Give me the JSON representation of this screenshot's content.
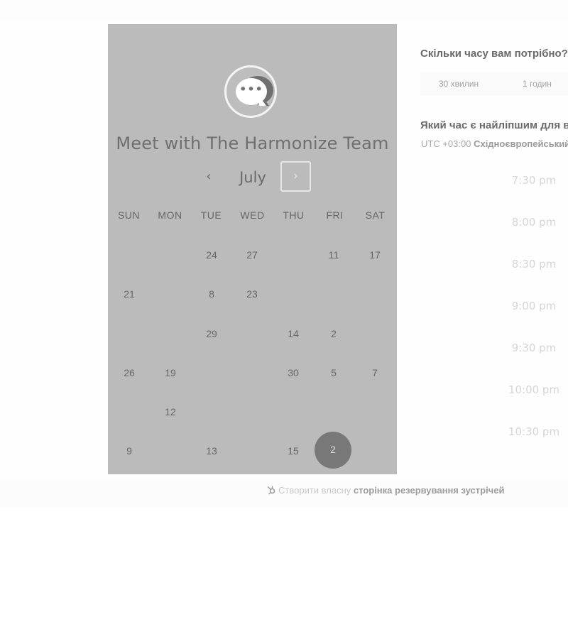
{
  "header": {
    "title": "Meet with The Harmonize Team"
  },
  "calendar": {
    "month": "July",
    "prev_label": "‹",
    "next_label": "›",
    "weekdays": [
      "SUN",
      "MON",
      "TUE",
      "WED",
      "THU",
      "FRI",
      "SAT"
    ],
    "days": [
      {
        "label": "24",
        "col": 2,
        "row": 0
      },
      {
        "label": "27",
        "col": 3,
        "row": 0
      },
      {
        "label": "11",
        "col": 5,
        "row": 0
      },
      {
        "label": "17",
        "col": 6,
        "row": 0
      },
      {
        "label": "21",
        "col": 0,
        "row": 1
      },
      {
        "label": "8",
        "col": 2,
        "row": 1
      },
      {
        "label": "23",
        "col": 3,
        "row": 1
      },
      {
        "label": "29",
        "col": 2,
        "row": 2
      },
      {
        "label": "14",
        "col": 4,
        "row": 2
      },
      {
        "label": "2",
        "col": 5,
        "row": 2
      },
      {
        "label": "26",
        "col": 0,
        "row": 3
      },
      {
        "label": "19",
        "col": 1,
        "row": 3
      },
      {
        "label": "30",
        "col": 4,
        "row": 3
      },
      {
        "label": "5",
        "col": 5,
        "row": 3
      },
      {
        "label": "7",
        "col": 6,
        "row": 3
      },
      {
        "label": "12",
        "col": 1,
        "row": 4
      },
      {
        "label": "9",
        "col": 0,
        "row": 5
      },
      {
        "label": "13",
        "col": 2,
        "row": 5
      },
      {
        "label": "15",
        "col": 4,
        "row": 5
      }
    ],
    "selected_day": "2"
  },
  "booking": {
    "duration_question": "Скільки часу вам потрібно?",
    "duration_options": [
      "30 хвилин",
      "1 годин"
    ],
    "time_question": "Який час є найліпшим для вас?",
    "timezone_offset": "UTC +03:00",
    "timezone_name": "Східноєвропейський час",
    "slots": [
      "7:30 pm",
      "8:00 pm",
      "8:30 pm",
      "9:00 pm",
      "9:30 pm",
      "10:00 pm",
      "10:30 pm"
    ]
  },
  "footer": {
    "light_text": "Створити власну",
    "bold_text": "сторінка резервування зустрічей"
  },
  "colors": {
    "panel_bg": "#bbbbbb",
    "selected_day_bg": "#787878"
  },
  "icons": {
    "logo": "chat-bubble-icon",
    "footer": "hubspot-sprocket-icon"
  }
}
